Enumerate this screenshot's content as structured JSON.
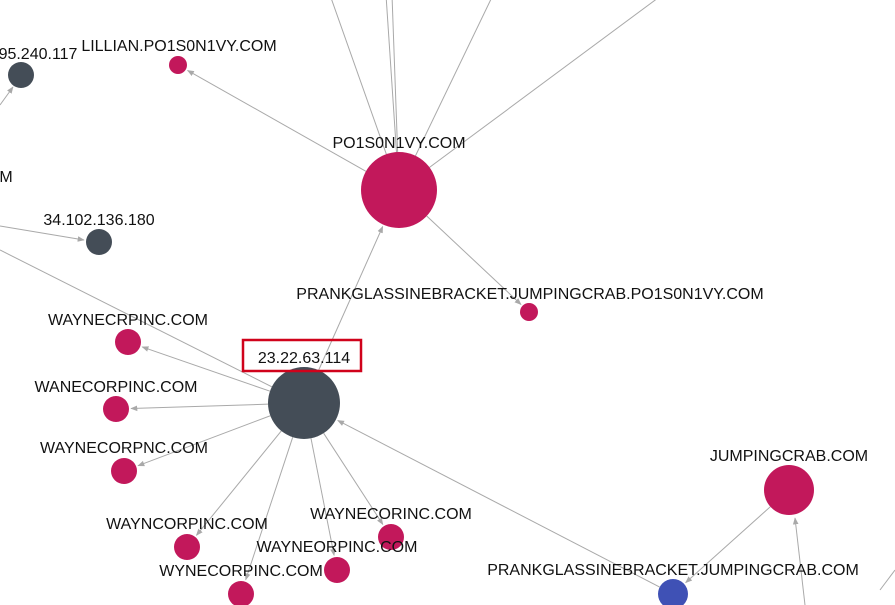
{
  "graph": {
    "colors": {
      "domain": "#c2185b",
      "ip": "#444d57",
      "host": "#3f51b5",
      "edge": "#a9a9a9",
      "highlight": "#d0021b"
    },
    "nodes": [
      {
        "id": "po1s0n1vy",
        "label": "PO1S0N1VY.COM",
        "kind": "domain"
      },
      {
        "id": "ip_23",
        "label": "23.22.63.114",
        "kind": "ip",
        "highlighted": true
      },
      {
        "id": "lillian",
        "label": "LILLIAN.PO1S0N1VY.COM",
        "kind": "domain"
      },
      {
        "id": "ip_195",
        "label": "95.240.117",
        "kind": "ip"
      },
      {
        "id": "ip_34",
        "label": "34.102.136.180",
        "kind": "ip"
      },
      {
        "id": "m_cut",
        "label": "M",
        "kind": "text"
      },
      {
        "id": "prank_po",
        "label": "PRANKGLASSINEBRACKET.JUMPINGCRAB.PO1S0N1VY.COM",
        "kind": "domain"
      },
      {
        "id": "waynecrpinc",
        "label": "WAYNECRPINC.COM",
        "kind": "domain"
      },
      {
        "id": "wanecorpinc",
        "label": "WANECORPINC.COM",
        "kind": "domain"
      },
      {
        "id": "waynecorpnc",
        "label": "WAYNECORPNC.COM",
        "kind": "domain"
      },
      {
        "id": "wayncorpinc",
        "label": "WAYNCORPINC.COM",
        "kind": "domain"
      },
      {
        "id": "waynecorinc",
        "label": "WAYNECORINC.COM",
        "kind": "domain"
      },
      {
        "id": "wayneorpinc",
        "label": "WAYNEORPINC.COM",
        "kind": "domain"
      },
      {
        "id": "wynecorpinc",
        "label": "WYNECORPINC.COM",
        "kind": "domain"
      },
      {
        "id": "jumpingcrab",
        "label": "JUMPINGCRAB.COM",
        "kind": "domain"
      },
      {
        "id": "prank_jc",
        "label": "PRANKGLASSINEBRACKET.JUMPINGCRAB.COM",
        "kind": "host"
      }
    ],
    "edges": [
      {
        "source": "po1s0n1vy",
        "target": "lillian"
      },
      {
        "source": "po1s0n1vy",
        "target": "prank_po"
      },
      {
        "source": "ip_23",
        "target": "po1s0n1vy"
      },
      {
        "source": "ip_23",
        "target": "waynecrpinc"
      },
      {
        "source": "ip_23",
        "target": "wanecorpinc"
      },
      {
        "source": "ip_23",
        "target": "waynecorpnc"
      },
      {
        "source": "ip_23",
        "target": "wayncorpinc"
      },
      {
        "source": "ip_23",
        "target": "waynecorinc"
      },
      {
        "source": "ip_23",
        "target": "wayneorpinc"
      },
      {
        "source": "ip_23",
        "target": "wynecorpinc"
      },
      {
        "source": "prank_jc",
        "target": "ip_23"
      },
      {
        "source": "jumpingcrab",
        "target": "prank_jc"
      }
    ]
  }
}
